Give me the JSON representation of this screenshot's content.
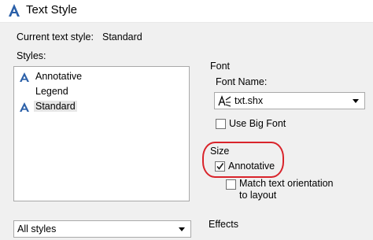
{
  "window": {
    "title": "Text Style",
    "icon": "autocad-text-style-icon"
  },
  "current_style": {
    "label": "Current text style:",
    "value": "Standard"
  },
  "styles": {
    "label": "Styles:",
    "items": [
      {
        "label": "Annotative",
        "icon": "annotative-icon",
        "selected": false
      },
      {
        "label": "Legend",
        "icon": "",
        "selected": false
      },
      {
        "label": "Standard",
        "icon": "annotative-icon",
        "selected": true
      }
    ],
    "filter": {
      "value": "All styles"
    }
  },
  "font": {
    "group_label": "Font",
    "name_label": "Font Name:",
    "name_value": "txt.shx",
    "name_icon": "shx-font-icon",
    "big_font_label": "Use Big Font",
    "big_font_checked": false
  },
  "size": {
    "group_label": "Size",
    "annotative_label": "Annotative",
    "annotative_checked": true,
    "match_label_line1": "Match text orientation",
    "match_label_line2": "to layout",
    "match_checked": false
  },
  "effects": {
    "group_label": "Effects"
  },
  "colors": {
    "highlight_circle": "#d9242b",
    "annotative_icon": "#2a5fa8"
  }
}
